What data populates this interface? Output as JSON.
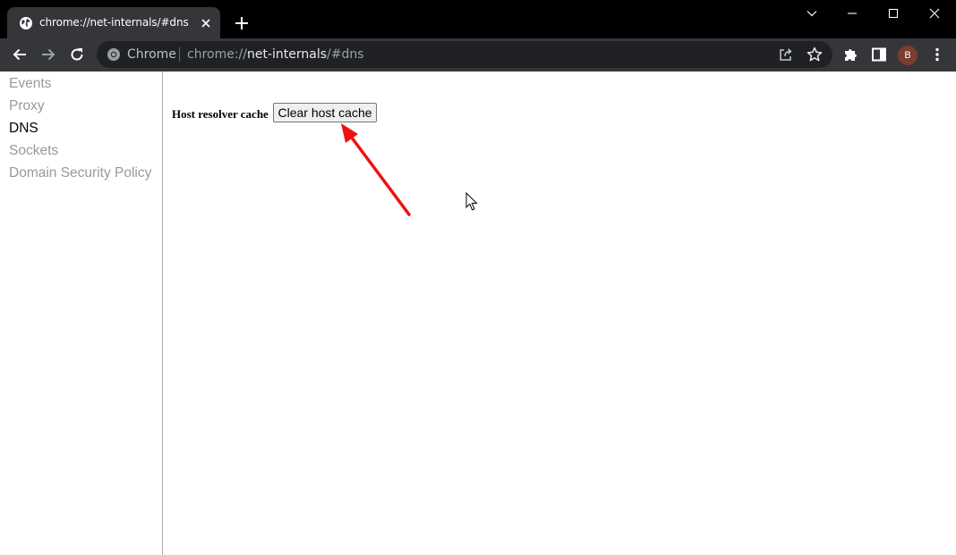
{
  "browser": {
    "tab": {
      "title": "chrome://net-internals/#dns",
      "favicon": "globe-icon"
    },
    "new_tab_icon": "plus-icon",
    "window_controls": [
      "chevron-down-icon",
      "minimize-icon",
      "maximize-icon",
      "close-icon"
    ],
    "toolbar": {
      "back_icon": "arrow-left-icon",
      "forward_icon": "arrow-right-icon",
      "reload_icon": "reload-icon",
      "omnibox": {
        "chip_label": "Chrome",
        "url_scheme": "chrome://",
        "url_host": "net-internals",
        "url_path": "/#dns"
      },
      "avatar_letter": "B",
      "accent_avatar": "#7a3e2e"
    }
  },
  "sidebar": {
    "items": [
      {
        "label": "Events",
        "active": false
      },
      {
        "label": "Proxy",
        "active": false
      },
      {
        "label": "DNS",
        "active": true
      },
      {
        "label": "Sockets",
        "active": false
      },
      {
        "label": "Domain Security Policy",
        "active": false
      }
    ]
  },
  "main": {
    "cache_label": "Host resolver cache",
    "clear_button_label": "Clear host cache"
  },
  "colors": {
    "tab_strip": "#000000",
    "toolbar": "#35363a",
    "omnibox": "#202124",
    "annotation_arrow": "#ee1111"
  }
}
